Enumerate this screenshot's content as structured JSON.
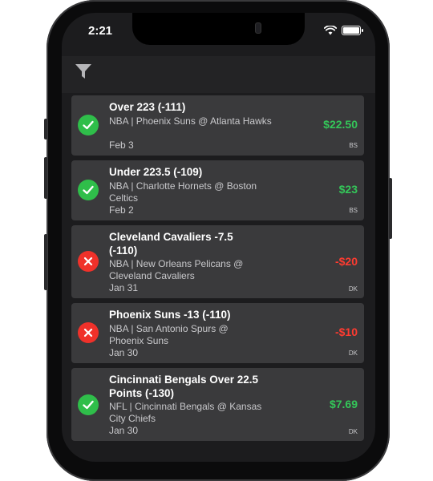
{
  "status_bar": {
    "time": "2:21"
  },
  "toolbar": {
    "filter_icon": "filter-icon"
  },
  "bets": [
    {
      "title": "Over 223 (-111)",
      "meta": "NBA | Phoenix Suns @ Atlanta Hawks",
      "date": "Feb 3",
      "amount": "$22.50",
      "book": "BS",
      "result": "won"
    },
    {
      "title": "Under 223.5 (-109)",
      "meta": "NBA | Charlotte Hornets @ Boston Celtics",
      "date": "Feb 2",
      "amount": "$23",
      "book": "BS",
      "result": "won"
    },
    {
      "title": "Cleveland Cavaliers -7.5 (-110)",
      "meta": "NBA | New Orleans Pelicans @ Cleveland Cavaliers",
      "date": "Jan 31",
      "amount": "-$20",
      "book": "DK",
      "result": "lost"
    },
    {
      "title": "Phoenix Suns -13 (-110)",
      "meta": "NBA | San Antonio Spurs @ Phoenix Suns",
      "date": "Jan 30",
      "amount": "-$10",
      "book": "DK",
      "result": "lost"
    },
    {
      "title": "Cincinnati Bengals Over 22.5 Points (-130)",
      "meta": "NFL | Cincinnati Bengals @ Kansas City Chiefs",
      "date": "Jan 30",
      "amount": "$7.69",
      "book": "DK",
      "result": "won"
    }
  ],
  "colors": {
    "won": "#34c759",
    "lost": "#ff3b30",
    "card": "#3a3a3c",
    "background": "#1c1c1e"
  }
}
